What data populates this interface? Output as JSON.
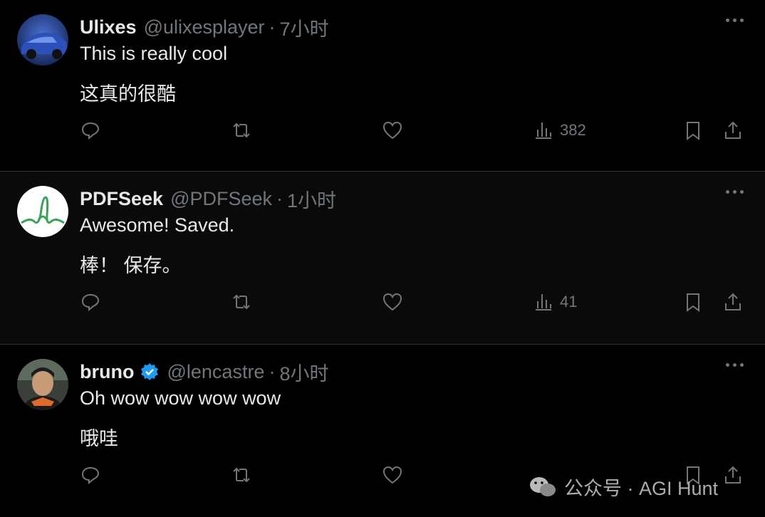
{
  "tweets": [
    {
      "name": "Ulixes",
      "handle": "@ulixesplayer",
      "sep": "·",
      "time": "7小时",
      "line1": "This is really cool",
      "line2": "这真的很酷",
      "views": "382",
      "verified": false,
      "avatar": "car-avatar"
    },
    {
      "name": "PDFSeek",
      "handle": "@PDFSeek",
      "sep": "·",
      "time": "1小时",
      "line1": "Awesome! Saved.",
      "line2": "棒！ 保存。",
      "views": "41",
      "verified": false,
      "avatar": "pdfseek-logo-avatar"
    },
    {
      "name": "bruno",
      "handle": "@lencastre",
      "sep": "·",
      "time": "8小时",
      "line1": "Oh wow wow wow wow",
      "line2": "哦哇",
      "views": "",
      "verified": true,
      "avatar": "person-avatar"
    }
  ],
  "watermark": {
    "text": "公众号 · AGI Hunt"
  },
  "colors": {
    "background": "#000000",
    "text": "#e7e9ea",
    "muted": "#71767b",
    "divider": "#2f3336",
    "verified": "#1d9bf0"
  }
}
